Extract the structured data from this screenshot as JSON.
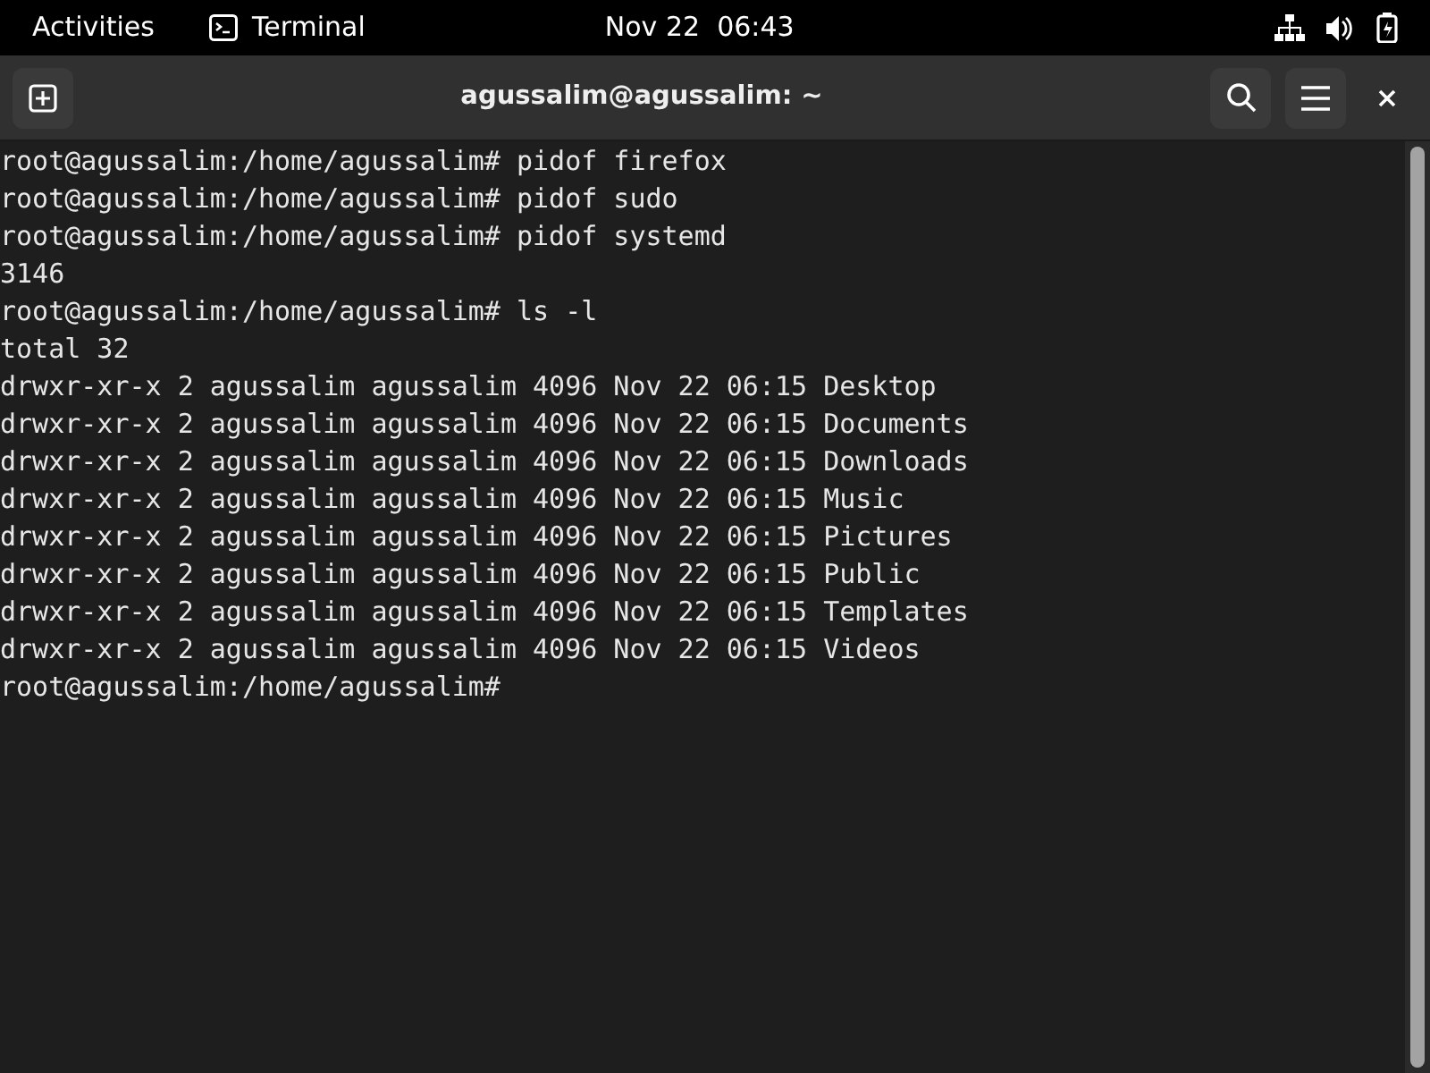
{
  "top_bar": {
    "activities": "Activities",
    "app_name": "Terminal",
    "clock": "Nov 22  06:43"
  },
  "window": {
    "title": "agussalim@agussalim: ~"
  },
  "terminal": {
    "lines": [
      "root@agussalim:/home/agussalim# pidof firefox",
      "root@agussalim:/home/agussalim# pidof sudo",
      "root@agussalim:/home/agussalim# pidof systemd",
      "3146",
      "root@agussalim:/home/agussalim# ls -l",
      "total 32",
      "drwxr-xr-x 2 agussalim agussalim 4096 Nov 22 06:15 Desktop",
      "drwxr-xr-x 2 agussalim agussalim 4096 Nov 22 06:15 Documents",
      "drwxr-xr-x 2 agussalim agussalim 4096 Nov 22 06:15 Downloads",
      "drwxr-xr-x 2 agussalim agussalim 4096 Nov 22 06:15 Music",
      "drwxr-xr-x 2 agussalim agussalim 4096 Nov 22 06:15 Pictures",
      "drwxr-xr-x 2 agussalim agussalim 4096 Nov 22 06:15 Public",
      "drwxr-xr-x 2 agussalim agussalim 4096 Nov 22 06:15 Templates",
      "drwxr-xr-x 2 agussalim agussalim 4096 Nov 22 06:15 Videos",
      "root@agussalim:/home/agussalim#"
    ]
  }
}
